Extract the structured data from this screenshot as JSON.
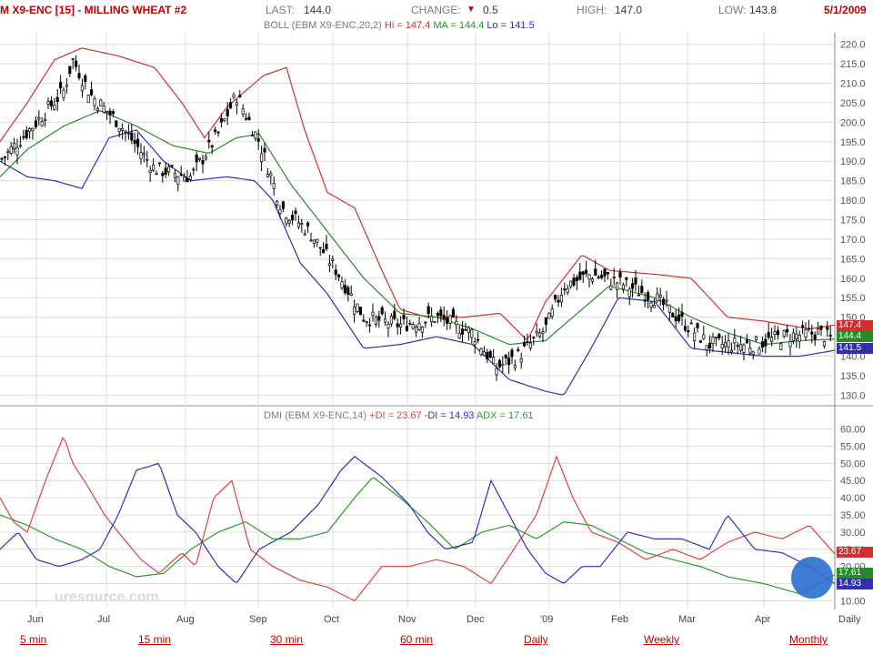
{
  "header": {
    "symbol": "M X9-ENC [15] - MILLING WHEAT #2",
    "last_label": "LAST:",
    "last_value": "144.0",
    "change_label": "CHANGE:",
    "change_arrow": "▼",
    "change_value": "0.5",
    "high_label": "HIGH:",
    "high_value": "147.0",
    "low_label": "LOW:",
    "low_value": "143.8",
    "date": "5/1/2009"
  },
  "boll_legend": {
    "prefix": "BOLL (EBM X9-ENC,20,2)",
    "hi": "Hi = 147.4",
    "ma": "MA = 144.4",
    "lo": "Lo = 141.5"
  },
  "dmi_legend": {
    "prefix": "DMI (EBM X9-ENC,14)",
    "pdi": "+DI = 23.67",
    "mdi": "-DI = 14.93",
    "adx": "ADX = 17.61"
  },
  "price_axis_labels": [
    "220.0",
    "215.0",
    "210.0",
    "205.0",
    "200.0",
    "195.0",
    "190.0",
    "185.0",
    "180.0",
    "175.0",
    "170.0",
    "165.0",
    "160.0",
    "155.0",
    "150.0",
    "145.0",
    "140.0",
    "135.0",
    "130.0"
  ],
  "dmi_axis_labels": [
    "60.00",
    "55.00",
    "50.00",
    "45.00",
    "40.00",
    "35.00",
    "30.00",
    "25.00",
    "20.00",
    "15.00",
    "10.00"
  ],
  "value_tags": {
    "hi": "147.4",
    "ma": "144.4",
    "lo": "141.5",
    "pdi": "23.67",
    "adx": "17.61",
    "mdi": "14.93"
  },
  "month_labels": [
    "Jun",
    "Jul",
    "Aug",
    "Sep",
    "Oct",
    "Nov",
    "Dec",
    "'09",
    "Feb",
    "Mar",
    "Apr"
  ],
  "daily_label": "Daily",
  "bottom_links": [
    "5 min",
    "15 min",
    "30 min",
    "60 min",
    "Daily",
    "Weekly",
    "Monthly"
  ],
  "watermark": "uresource.com",
  "colors": {
    "hi": "#d03030",
    "ma": "#2a8a2a",
    "lo": "#3030b0",
    "pdi": "#e04040",
    "mdi": "#3030c0",
    "adx": "#2a9a2a",
    "price": "#000000"
  },
  "chart_data": [
    {
      "type": "candlestick",
      "title": "MILLING WHEAT #2 with Bollinger Bands (20,2)",
      "x": [
        "2008-05-20",
        "2008-06-15",
        "2008-07-01",
        "2008-08-01",
        "2008-08-20",
        "2008-09-01",
        "2008-10-01",
        "2008-11-01",
        "2008-12-01",
        "2008-12-15",
        "2009-01-01",
        "2009-01-20",
        "2009-02-01",
        "2009-03-01",
        "2009-04-01",
        "2009-05-01"
      ],
      "series": [
        {
          "name": "Close",
          "values": [
            195,
            215,
            205,
            185,
            205,
            195,
            165,
            150,
            145,
            140,
            150,
            160,
            158,
            145,
            142,
            144
          ]
        },
        {
          "name": "Hi",
          "values": [
            210,
            218,
            215,
            200,
            210,
            215,
            185,
            155,
            152,
            148,
            160,
            165,
            164,
            150,
            148,
            147.4
          ]
        },
        {
          "name": "MA",
          "values": [
            190,
            200,
            205,
            190,
            192,
            197,
            175,
            150,
            148,
            142,
            146,
            158,
            155,
            146,
            143,
            144.4
          ]
        },
        {
          "name": "Lo",
          "values": [
            188,
            185,
            198,
            182,
            185,
            185,
            155,
            143,
            140,
            130,
            132,
            155,
            152,
            141,
            140,
            141.5
          ]
        }
      ],
      "ylim": [
        128,
        222
      ]
    },
    {
      "type": "line",
      "title": "DMI (EBM X9-ENC,14)",
      "series": [
        {
          "name": "+DI",
          "values": [
            35,
            55,
            42,
            20,
            45,
            25,
            12,
            25,
            20,
            28,
            50,
            35,
            28,
            25,
            28,
            23.67
          ]
        },
        {
          "name": "-DI",
          "values": [
            18,
            12,
            25,
            48,
            20,
            35,
            50,
            30,
            40,
            30,
            15,
            18,
            30,
            32,
            28,
            14.93
          ]
        },
        {
          "name": "ADX",
          "values": [
            30,
            28,
            22,
            18,
            28,
            30,
            45,
            35,
            25,
            30,
            33,
            30,
            22,
            18,
            15,
            17.61
          ]
        }
      ],
      "ylim": [
        8,
        62
      ]
    }
  ]
}
